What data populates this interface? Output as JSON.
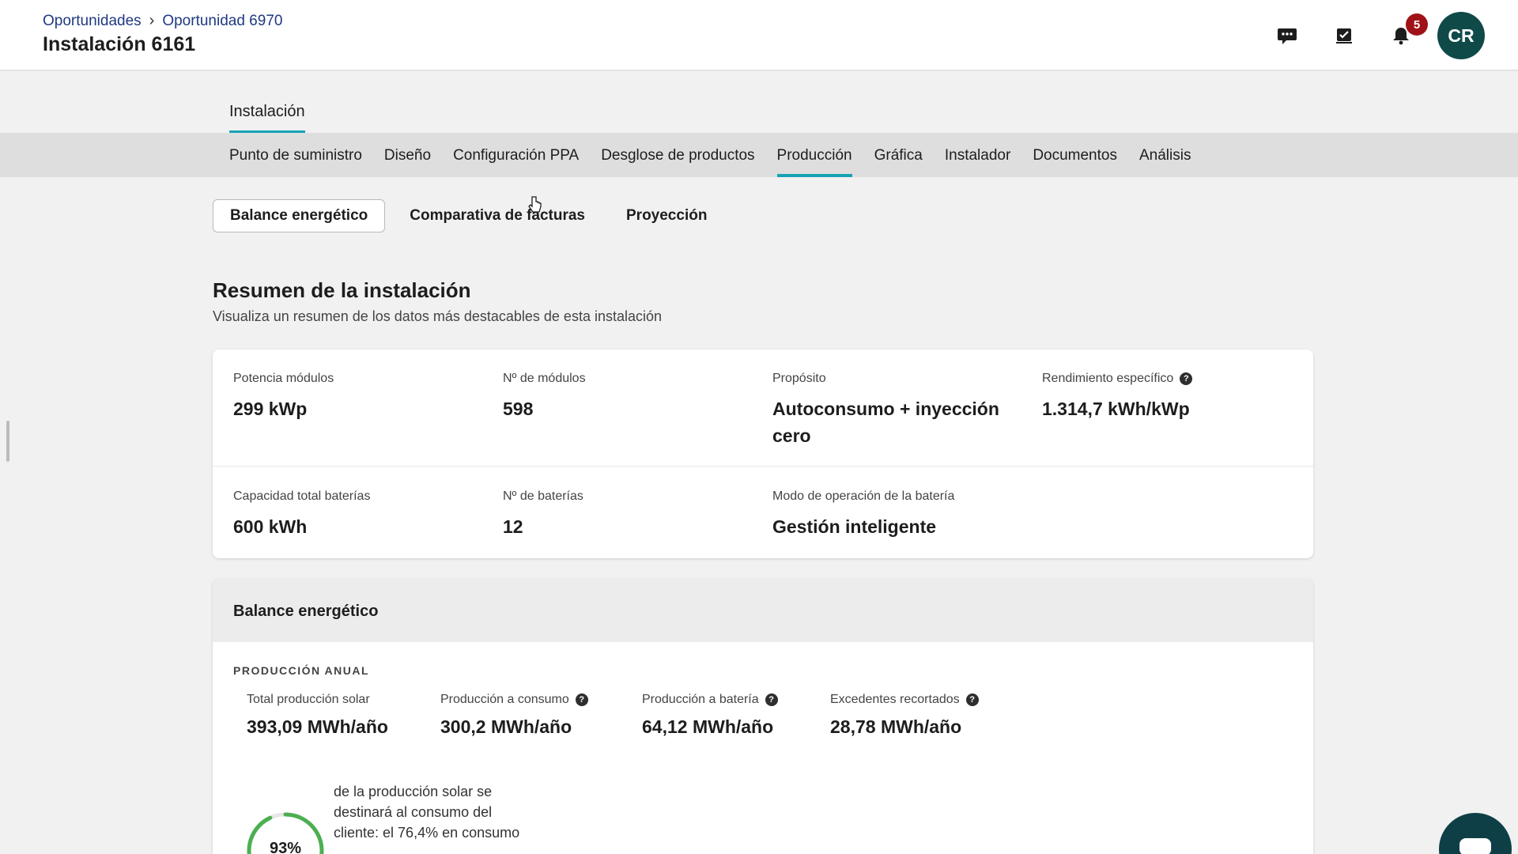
{
  "header": {
    "breadcrumb": [
      "Oportunidades",
      "Oportunidad 6970"
    ],
    "title": "Instalación 6161",
    "icons": [
      "chat-icon",
      "tasks-icon",
      "bell-icon"
    ],
    "notifications_count": "5",
    "avatar_initials": "CR"
  },
  "tabs": {
    "primary": "Instalación",
    "secondary": [
      "Punto de suministro",
      "Diseño",
      "Configuración PPA",
      "Desglose de productos",
      "Producción",
      "Gráfica",
      "Instalador",
      "Documentos",
      "Análisis"
    ],
    "secondary_active": "Producción",
    "pills": [
      "Balance energético",
      "Comparativa de facturas",
      "Proyección"
    ],
    "pill_active": "Balance energético"
  },
  "summary": {
    "title": "Resumen de la instalación",
    "subtitle": "Visualiza un resumen de los datos más destacables de esta instalación",
    "rows": [
      [
        {
          "label": "Potencia módulos",
          "value": "299 kWp"
        },
        {
          "label": "Nº de módulos",
          "value": "598"
        },
        {
          "label": "Propósito",
          "value": "Autoconsumo + inyección cero"
        },
        {
          "label": "Rendimiento específico",
          "value": "1.314,7 kWh/kWp",
          "help": true
        }
      ],
      [
        {
          "label": "Capacidad total baterías",
          "value": "600 kWh"
        },
        {
          "label": "Nº de baterías",
          "value": "12"
        },
        {
          "label": "Modo de operación de la batería",
          "value": "Gestión inteligente"
        }
      ]
    ]
  },
  "balance": {
    "title": "Balance energético",
    "section_label": "PRODUCCIÓN ANUAL",
    "metrics": [
      {
        "label": "Total producción solar",
        "value": "393,09 MWh/año",
        "help": false
      },
      {
        "label": "Producción a consumo",
        "value": "300,2 MWh/año",
        "help": true
      },
      {
        "label": "Producción a batería",
        "value": "64,12 MWh/año",
        "help": true
      },
      {
        "label": "Excedentes recortados",
        "value": "28,78 MWh/año",
        "help": true
      }
    ],
    "ring_percent": "93%",
    "ring_fraction": 0.93,
    "description": "de la producción solar se destinará al consumo del cliente: el 76,4% en consumo"
  },
  "colors": {
    "accent": "#16a3b4",
    "link": "#1f3a82",
    "badge": "#a01218",
    "avatar": "#0f4a49",
    "ring": "#4caf50"
  }
}
